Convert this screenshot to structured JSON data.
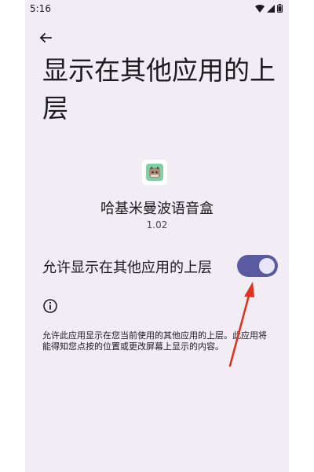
{
  "status_bar": {
    "time": "5:16",
    "icons": [
      "wifi-icon",
      "signal-icon",
      "battery-icon"
    ]
  },
  "header": {
    "back_icon": "arrow-left-icon",
    "title": "显示在其他应用的上层"
  },
  "app": {
    "icon": "app-icon",
    "name": "哈基米曼波语音盒",
    "version": "1.02"
  },
  "permission": {
    "label": "允许显示在其他应用的上层",
    "enabled": true
  },
  "info": {
    "icon": "info-icon",
    "description": "允许此应用显示在您当前使用的其他应用的上层。此应用将能得知您点按的位置或更改屏幕上显示的内容。"
  },
  "colors": {
    "background": "#f2edf5",
    "toggle_on": "#5a5aa0",
    "annotation_arrow": "#e03020"
  }
}
